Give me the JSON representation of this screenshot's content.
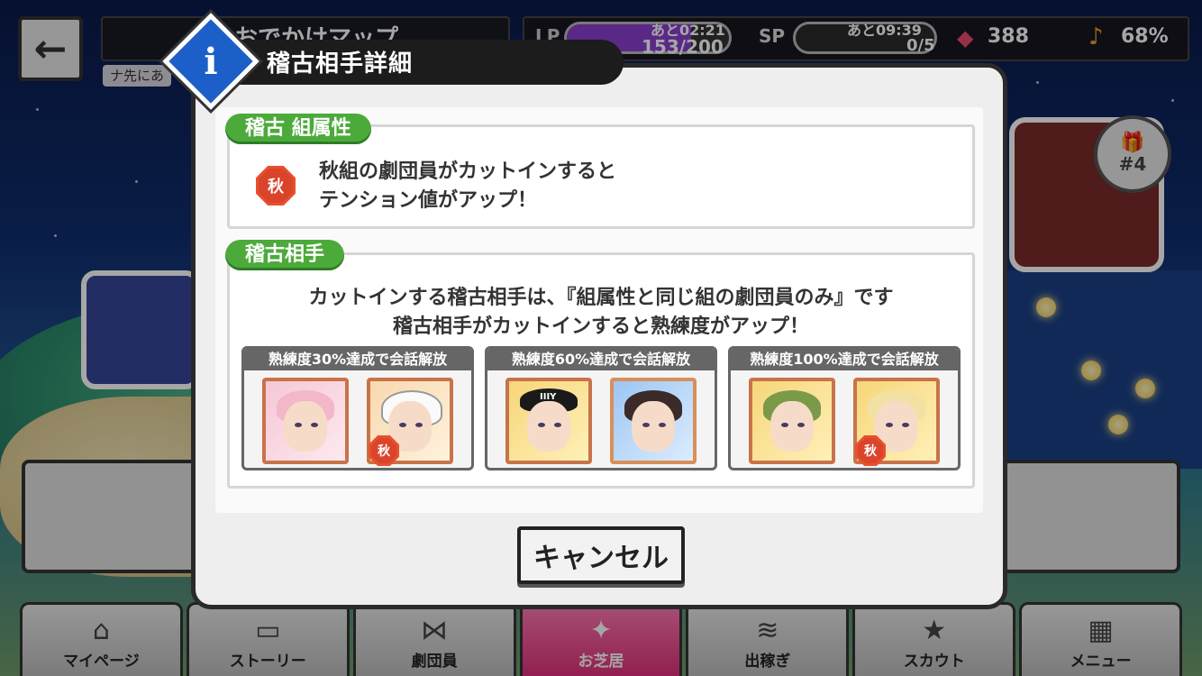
{
  "header": {
    "back_label": "←",
    "map_title": "おでかけマップ",
    "map_subtitle": "ナ先にあ",
    "lp_label": "LP",
    "lp_timer": "あと02:21",
    "lp_count": "153/200",
    "lp_fraction": 0.765,
    "sp_label": "SP",
    "sp_timer": "あと09:39",
    "sp_count": "0/5",
    "gem_icon": "gem-icon",
    "gem_count": "388",
    "note_icon": "music-note-icon",
    "note_percent": "68%"
  },
  "gift_badge": {
    "label": "#4",
    "icon": "gift-icon"
  },
  "dialog": {
    "title": "稽古相手詳細",
    "info_glyph": "i",
    "attribute_section": {
      "tab_label": "稽古 組属性",
      "badge": "秋",
      "line1": "秋組の劇団員がカットインすると",
      "line2": "テンション値がアップ！"
    },
    "partner_section": {
      "tab_label": "稽古相手",
      "line1": "カットインする稽古相手は、『組属性と同じ組の劇団員のみ』です",
      "line2": "稽古相手がカットインすると熟練度がアップ！"
    },
    "stages": [
      {
        "header": "熟練度30%達成で会話解放",
        "badge": "秋"
      },
      {
        "header": "熟練度60%達成で会話解放",
        "cap_text": "IIIY"
      },
      {
        "header": "熟練度100%達成で会話解放",
        "badge": "秋"
      }
    ],
    "cancel_label": "キャンセル"
  },
  "bottom_nav": [
    {
      "label": "マイページ",
      "icon": "home-icon",
      "glyph": "⌂"
    },
    {
      "label": "ストーリー",
      "icon": "book-icon",
      "glyph": "▭"
    },
    {
      "label": "劇団員",
      "icon": "bowtie-icon",
      "glyph": "⋈"
    },
    {
      "label": "お芝居",
      "icon": "theater-icon",
      "glyph": "✦"
    },
    {
      "label": "出稼ぎ",
      "icon": "coins-icon",
      "glyph": "≋"
    },
    {
      "label": "スカウト",
      "icon": "star-icon",
      "glyph": "★"
    },
    {
      "label": "メニュー",
      "icon": "grid-icon",
      "glyph": "▦"
    }
  ],
  "colors": {
    "accent_green": "#4caa3b",
    "info_blue": "#1d5fc9",
    "autumn_red": "#e8502e",
    "nav_active": "#e0307a",
    "lp_purple": "#8a3fd0"
  }
}
